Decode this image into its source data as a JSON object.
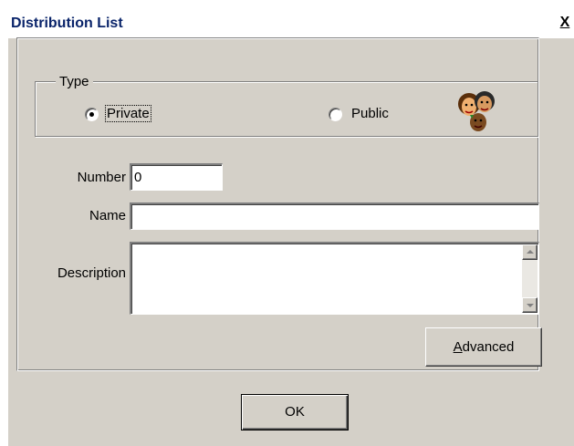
{
  "window": {
    "title": "Distribution List",
    "close_glyph": "X"
  },
  "type_group": {
    "legend": "Type",
    "options": [
      {
        "label": "Private",
        "selected": true
      },
      {
        "label": "Public",
        "selected": false
      }
    ],
    "icon": "group-people-icon"
  },
  "fields": {
    "number_label": "Number",
    "number_value": "0",
    "name_label": "Name",
    "name_value": "",
    "description_label": "Description",
    "description_value": ""
  },
  "buttons": {
    "advanced_accel": "A",
    "advanced_rest": "dvanced",
    "ok": "OK"
  }
}
